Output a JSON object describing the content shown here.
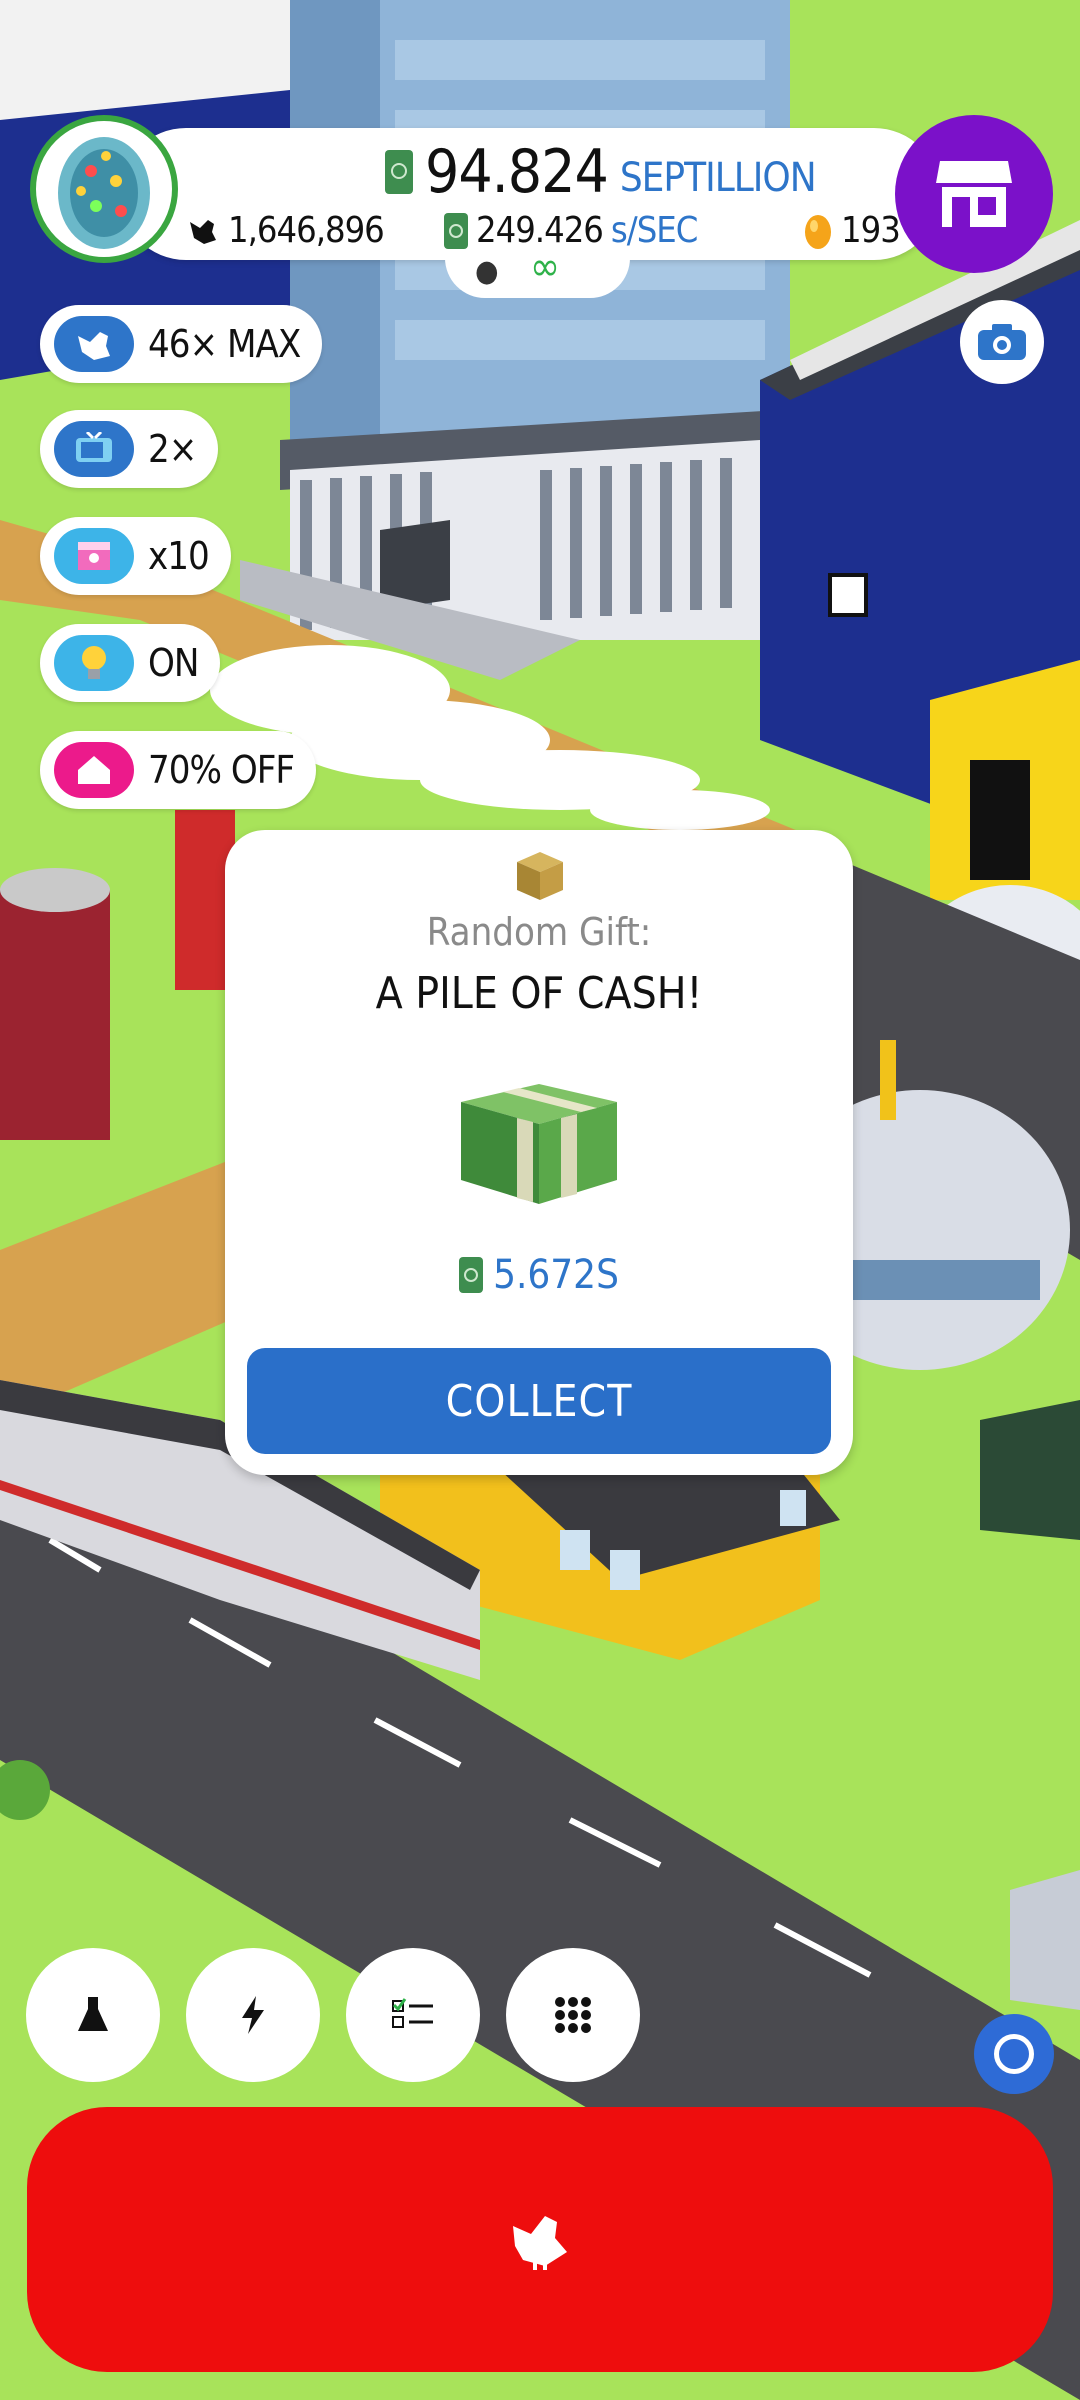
{
  "hud": {
    "cash_amount": "94.824",
    "cash_unit": "SEPTILLION",
    "chicken_count": "1,646,896",
    "income_rate": "249.426",
    "income_unit": "s/SEC",
    "golden_eggs": "193"
  },
  "boosts": [
    {
      "label": "46× MAX",
      "icon": "chicken-icon",
      "color": "#2e75c9"
    },
    {
      "label": "2×",
      "icon": "tv-icon",
      "color": "#2e75c9"
    },
    {
      "label": "x10",
      "icon": "box-icon",
      "color": "#3db4e8"
    },
    {
      "label": "ON",
      "icon": "lightbulb-icon",
      "color": "#3db4e8"
    },
    {
      "label": "70% OFF",
      "icon": "house-icon",
      "color": "#ec1a8b"
    }
  ],
  "gift": {
    "label": "Random Gift:",
    "name": "A PILE OF CASH!",
    "amount": "5.672S",
    "collect_label": "COLLECT"
  },
  "bottom_buttons": [
    "research-icon",
    "boost-icon",
    "missions-icon",
    "menu-grid-icon"
  ],
  "colors": {
    "grass": "#a8e35a",
    "hatch": "#ee0d0d",
    "accent_blue": "#2e75c9",
    "shop_purple": "#7b11c9",
    "avatar_ring": "#3aa640"
  }
}
